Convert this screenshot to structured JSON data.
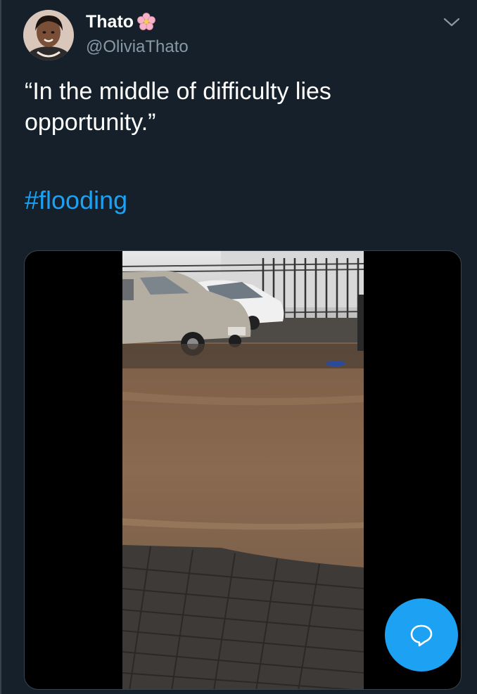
{
  "tweet": {
    "display_name": "Thato",
    "name_emoji": "flower-icon",
    "handle": "@OliviaThato",
    "text_line1": "“In the middle of difficulty lies",
    "text_line2": "opportunity.”",
    "hashtag": "#flooding",
    "media_icon": "video-thumbnail"
  },
  "fab": {
    "icon": "chat-bubble-icon"
  },
  "colors": {
    "background": "#15202b",
    "accent": "#1da1f2",
    "secondary_text": "#8899a6",
    "border": "#38444d"
  }
}
